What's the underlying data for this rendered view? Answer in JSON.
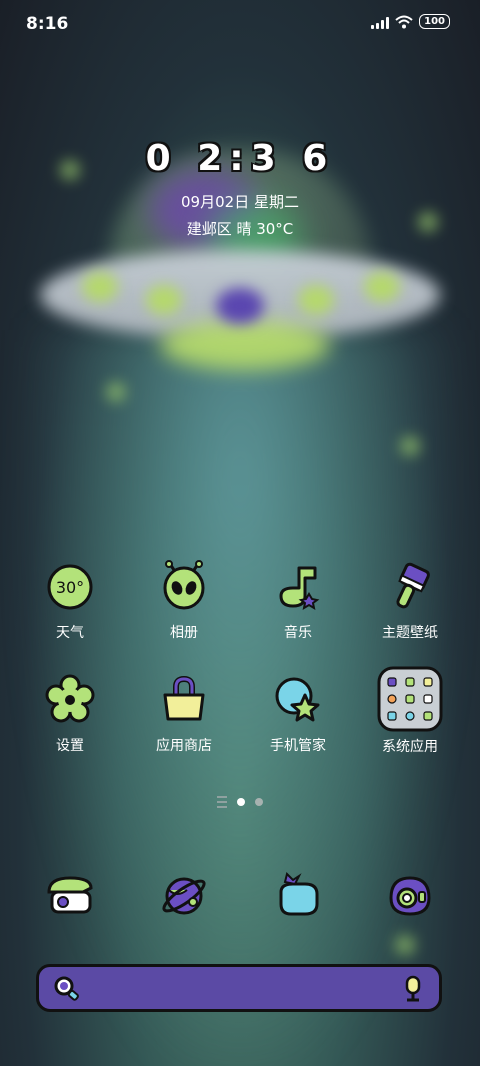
{
  "status_bar": {
    "time": "8:16",
    "battery": "100"
  },
  "clock_widget": {
    "time": "0 2:3 6",
    "date": "09月02日 星期二",
    "weather": "建邺区 晴 30°C"
  },
  "apps": [
    {
      "label": "天气",
      "icon": "weather-icon",
      "icon_text": "30°"
    },
    {
      "label": "相册",
      "icon": "alien-gallery-icon"
    },
    {
      "label": "音乐",
      "icon": "music-note-icon"
    },
    {
      "label": "主题壁纸",
      "icon": "paintbrush-icon"
    },
    {
      "label": "设置",
      "icon": "flower-gear-icon"
    },
    {
      "label": "应用商店",
      "icon": "shopping-bag-icon"
    },
    {
      "label": "手机管家",
      "icon": "shield-star-icon"
    },
    {
      "label": "系统应用",
      "icon": "folder-icon"
    }
  ],
  "dock": [
    {
      "icon": "phone-icon"
    },
    {
      "icon": "planet-browser-icon"
    },
    {
      "icon": "potion-messages-icon"
    },
    {
      "icon": "camera-icon"
    }
  ],
  "pager": {
    "pages": 2,
    "active": 1
  },
  "colors": {
    "accent_green": "#b3e27a",
    "accent_purple": "#6b4fc3",
    "search_bg": "#5b4aa5"
  }
}
